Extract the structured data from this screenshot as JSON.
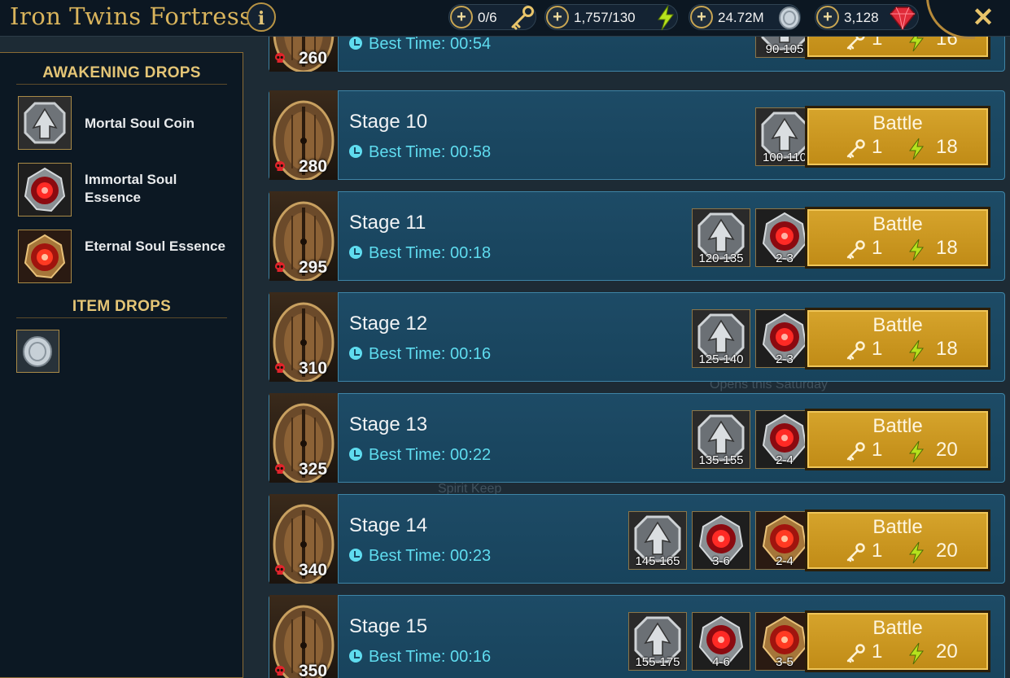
{
  "header": {
    "title": "Iron Twins Fortress",
    "info_icon": "info-icon",
    "close_icon": "close-icon",
    "resources": [
      {
        "name": "keys",
        "value": "0/6",
        "icon": "key-icon",
        "color": "#e8c46a"
      },
      {
        "name": "energy",
        "value": "1,757/130",
        "icon": "energy-icon",
        "color": "#b6e21d"
      },
      {
        "name": "silver",
        "value": "24.72M",
        "icon": "silver-coin-icon",
        "color": "#c9d3db"
      },
      {
        "name": "gems",
        "value": "3,128",
        "icon": "gem-icon",
        "color": "#e02b3a"
      }
    ]
  },
  "panel": {
    "awakening_title": "AWAKENING DROPS",
    "awakening_items": [
      {
        "label": "Mortal Soul Coin",
        "icon": "mortal-soul-coin-icon"
      },
      {
        "label": "Immortal Soul Essence",
        "icon": "immortal-soul-essence-icon"
      },
      {
        "label": "Eternal Soul Essence",
        "icon": "eternal-soul-essence-icon"
      }
    ],
    "item_title": "ITEM DROPS",
    "item_icon": "silver-coin-icon"
  },
  "stages": [
    {
      "name": "",
      "power": "260",
      "best_time": "Best Time: 00:54",
      "drops": [
        "90-105"
      ],
      "battle_label": "Battle",
      "key_cost": "1",
      "energy_cost": "16"
    },
    {
      "name": "Stage 10",
      "power": "280",
      "best_time": "Best Time: 00:58",
      "drops": [
        "100-110"
      ],
      "battle_label": "Battle",
      "key_cost": "1",
      "energy_cost": "18"
    },
    {
      "name": "Stage 11",
      "power": "295",
      "best_time": "Best Time: 00:18",
      "drops": [
        "120-135",
        "2-3"
      ],
      "battle_label": "Battle",
      "key_cost": "1",
      "energy_cost": "18"
    },
    {
      "name": "Stage 12",
      "power": "310",
      "best_time": "Best Time: 00:16",
      "drops": [
        "125-140",
        "2-3"
      ],
      "battle_label": "Battle",
      "key_cost": "1",
      "energy_cost": "18"
    },
    {
      "name": "Stage 13",
      "power": "325",
      "best_time": "Best Time: 00:22",
      "drops": [
        "135-155",
        "2-4"
      ],
      "battle_label": "Battle",
      "key_cost": "1",
      "energy_cost": "20"
    },
    {
      "name": "Stage 14",
      "power": "340",
      "best_time": "Best Time: 00:23",
      "drops": [
        "145-165",
        "3-6",
        "2-4"
      ],
      "battle_label": "Battle",
      "key_cost": "1",
      "energy_cost": "20"
    },
    {
      "name": "Stage 15",
      "power": "350",
      "best_time": "Best Time: 00:16",
      "drops": [
        "155-175",
        "4-6",
        "3-5"
      ],
      "battle_label": "Battle",
      "key_cost": "1",
      "energy_cost": "20"
    }
  ],
  "background_text": [
    "Opens this Saturday",
    "Spirit Keep"
  ]
}
